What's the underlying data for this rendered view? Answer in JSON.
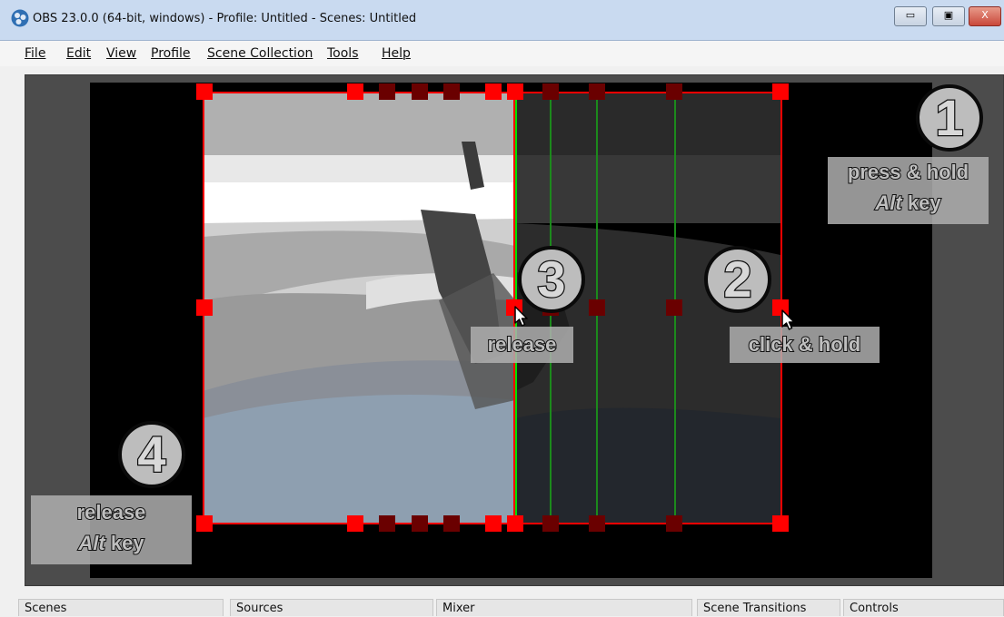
{
  "window": {
    "title": "OBS 23.0.0 (64-bit, windows) - Profile: Untitled - Scenes: Untitled",
    "minimize_label": "–",
    "restore_label": "□",
    "close_label": "X"
  },
  "menu": [
    "File",
    "Edit",
    "View",
    "Profile",
    "Scene Collection",
    "Tools",
    "Help"
  ],
  "steps": {
    "step1": {
      "number": "1",
      "line1": "press & hold",
      "line2_bold": "Alt",
      "line2_rest": " key"
    },
    "step2": {
      "number": "2",
      "label": "click & hold"
    },
    "step3": {
      "number": "3",
      "label": "release"
    },
    "step4": {
      "number": "4",
      "line1": "release",
      "line2_bold": "Alt",
      "line2_rest": " key"
    }
  },
  "docks": [
    "Scenes",
    "Sources",
    "Mixer",
    "Scene Transitions",
    "Controls"
  ],
  "colors": {
    "selection": "#ff0000",
    "crop_guide": "#00e000",
    "canvas": "#000000",
    "titlebar": "#c9daf0"
  }
}
